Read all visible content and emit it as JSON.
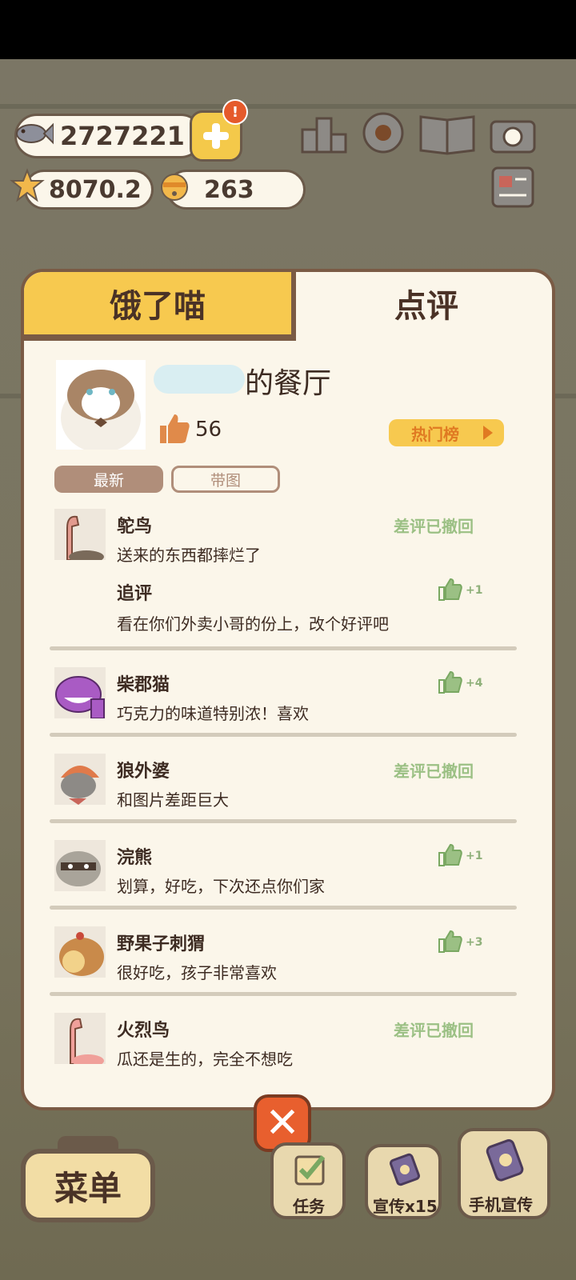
{
  "hud": {
    "fish": "2727221",
    "star": "8070.2",
    "bell": "263",
    "alert": "!"
  },
  "panel": {
    "tab_left": "饿了喵",
    "tab_right": "点评",
    "restaurant_title": "的餐厅",
    "likes": "56",
    "hot_label": "热门榜",
    "filter_new": "最新",
    "filter_img": "带图"
  },
  "reviews": [
    {
      "name": "鸵鸟",
      "text": "送来的东西都摔烂了",
      "status": "差评已撤回",
      "followup_label": "追评",
      "followup_text": "看在你们外卖小哥的份上，改个好评吧",
      "followup_likes": "+1",
      "avatar": "ostrich-avatar"
    },
    {
      "name": "柴郡猫",
      "text": "巧克力的味道特别浓！喜欢",
      "likes": "+4",
      "avatar": "cheshire-cat-avatar"
    },
    {
      "name": "狼外婆",
      "text": "和图片差距巨大",
      "status": "差评已撤回",
      "avatar": "wolf-grandma-avatar"
    },
    {
      "name": "浣熊",
      "text": "划算，好吃，下次还点你们家",
      "likes": "+1",
      "avatar": "raccoon-avatar"
    },
    {
      "name": "野果子刺猬",
      "text": "很好吃，孩子非常喜欢",
      "likes": "+3",
      "avatar": "hedgehog-avatar"
    },
    {
      "name": "火烈鸟",
      "text": "瓜还是生的，完全不想吃",
      "status": "差评已撤回",
      "avatar": "flamingo-avatar"
    }
  ],
  "bottom": {
    "close": "✕",
    "menu": "菜单",
    "task": "任务",
    "promo": "宣传x15",
    "phone_promo": "手机宣传"
  },
  "colors": {
    "panel_bg": "#fbf6ea",
    "tab_active": "#f7c94f",
    "border": "#7a5b45",
    "revoked_green": "#9bc084"
  }
}
